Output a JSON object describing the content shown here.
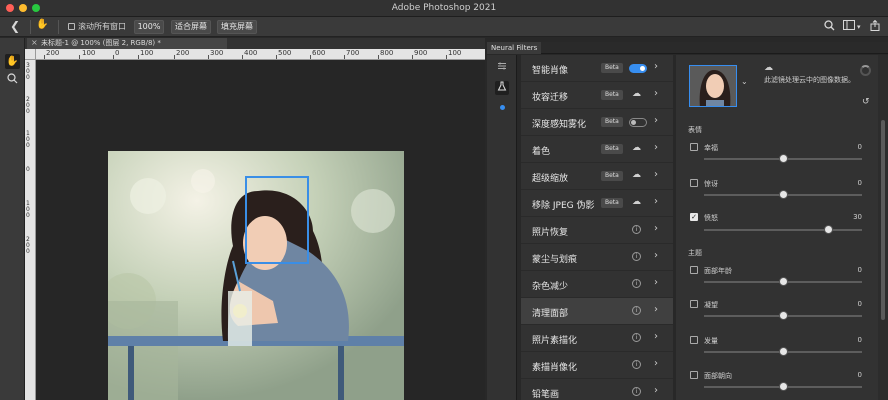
{
  "app": {
    "title": "Adobe Photoshop 2021"
  },
  "options_bar": {
    "scroll_all_windows": "滚动所有窗口",
    "zoom_value": "100%",
    "fit_screen": "适合屏幕",
    "fill_screen": "填充屏幕"
  },
  "document": {
    "tab_title": "未标题-1 @ 100% (图层 2, RGB/8) *"
  },
  "ruler": {
    "h_ticks": [
      "200",
      "100",
      "0",
      "100",
      "200",
      "300",
      "400",
      "500",
      "600",
      "700",
      "800",
      "900",
      "100"
    ],
    "v_ticks": [
      "3",
      "0",
      "0",
      "2",
      "0",
      "0",
      "1",
      "0",
      "0",
      "0",
      "1",
      "0",
      "0",
      "2",
      "0",
      "0"
    ]
  },
  "neural_filters": {
    "tab_label": "Neural Filters",
    "filters": [
      {
        "label": "智能肖像",
        "badge": "Beta",
        "status": "toggle-on"
      },
      {
        "label": "妆容迁移",
        "badge": "Beta",
        "status": "cloud"
      },
      {
        "label": "深度感知雾化",
        "badge": "Beta",
        "status": "toggle-off"
      },
      {
        "label": "着色",
        "badge": "Beta",
        "status": "cloud"
      },
      {
        "label": "超级缩放",
        "badge": "Beta",
        "status": "cloud"
      },
      {
        "label": "移除 JPEG 伪影",
        "badge": "Beta",
        "status": "cloud"
      },
      {
        "label": "照片恢复",
        "badge": "",
        "status": "info"
      },
      {
        "label": "蒙尘与划痕",
        "badge": "",
        "status": "info"
      },
      {
        "label": "杂色减少",
        "badge": "",
        "status": "info"
      },
      {
        "label": "清理面部",
        "badge": "",
        "status": "info"
      },
      {
        "label": "照片素描化",
        "badge": "",
        "status": "info"
      },
      {
        "label": "素描肖像化",
        "badge": "",
        "status": "info"
      },
      {
        "label": "铅笔画",
        "badge": "",
        "status": "info"
      }
    ],
    "info_glyph": "i"
  },
  "settings": {
    "description": "此滤镜处理云中的图像数据。",
    "section_expression": "表情",
    "section_theme": "主题",
    "options": [
      {
        "label": "幸福",
        "value": "0",
        "checked": false,
        "level": 0.5
      },
      {
        "label": "惊讶",
        "value": "0",
        "checked": false,
        "level": 0.5
      },
      {
        "label": "愤怒",
        "value": "30",
        "checked": true,
        "level": 0.65
      },
      {
        "label": "面部年龄",
        "value": "0",
        "checked": false,
        "level": 0.5
      },
      {
        "label": "凝望",
        "value": "0",
        "checked": false,
        "level": 0.5
      },
      {
        "label": "发量",
        "value": "0",
        "checked": false,
        "level": 0.5
      },
      {
        "label": "面部朝向",
        "value": "0",
        "checked": false,
        "level": 0.5
      }
    ]
  },
  "colors": {
    "accent": "#378ef0",
    "panel": "#323232",
    "background": "#282828"
  }
}
